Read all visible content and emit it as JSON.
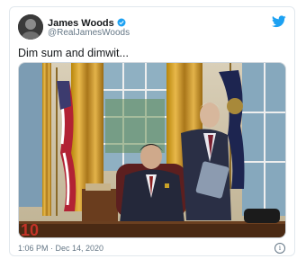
{
  "tweet": {
    "author_name": "James Woods",
    "handle": "@RealJamesWoods",
    "text": "Dim sum and dimwit...",
    "timestamp": "1:06 PM · Dec 14, 2020",
    "verified": true
  },
  "icons": {
    "brand": "twitter-bird-icon",
    "verified": "verified-badge-icon",
    "info": "info-icon"
  },
  "colors": {
    "accent": "#1da1f2",
    "text": "#14171a",
    "muted": "#657786",
    "border": "#e1e8ed"
  },
  "info_glyph": "i"
}
